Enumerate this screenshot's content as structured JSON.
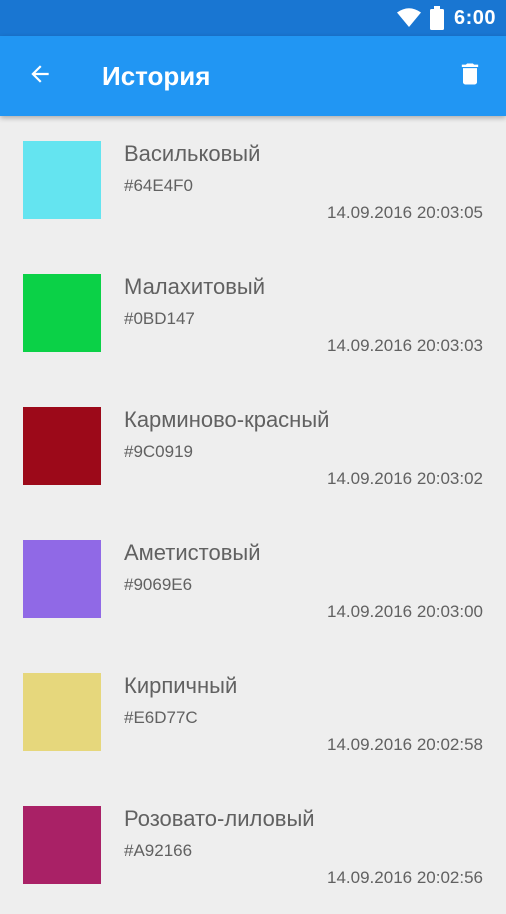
{
  "status_bar": {
    "time": "6:00",
    "icons": [
      "wifi-icon",
      "battery-icon"
    ]
  },
  "app_bar": {
    "title": "История",
    "back_icon": "arrow-back-icon",
    "delete_icon": "trash-icon",
    "color": "#2196F3"
  },
  "history": [
    {
      "name": "Васильковый",
      "hex": "#64E4F0",
      "timestamp": "14.09.2016 20:03:05"
    },
    {
      "name": "Малахитовый",
      "hex": "#0BD147",
      "timestamp": "14.09.2016 20:03:03"
    },
    {
      "name": "Карминово-красный",
      "hex": "#9C0919",
      "timestamp": "14.09.2016 20:03:02"
    },
    {
      "name": "Аметистовый",
      "hex": "#9069E6",
      "timestamp": "14.09.2016 20:03:00"
    },
    {
      "name": "Кирпичный",
      "hex": "#E6D77C",
      "timestamp": "14.09.2016 20:02:58"
    },
    {
      "name": "Розовато-лиловый",
      "hex": "#A92166",
      "timestamp": "14.09.2016 20:02:56"
    }
  ]
}
